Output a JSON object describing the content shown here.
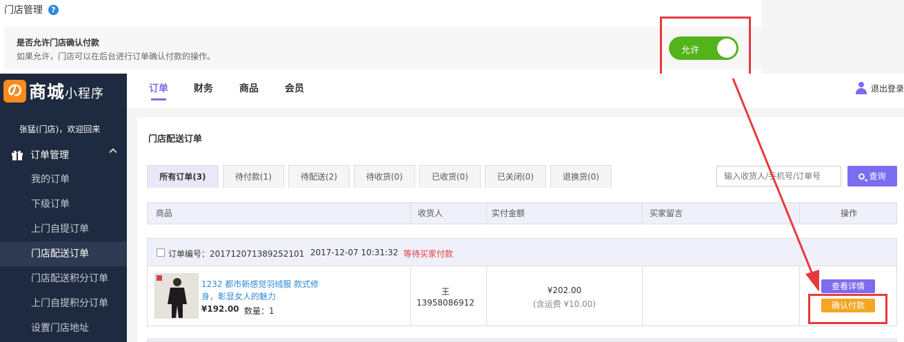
{
  "page": {
    "title": "门店管理",
    "help_icon": "help-icon"
  },
  "setting": {
    "title": "是否允许门店确认付款",
    "description": "如果允许，门店可以在后台进行订单确认付款的操作。",
    "toggle_label": "允许",
    "toggle_on": true,
    "toggle_color": "#52b31a"
  },
  "sidebar": {
    "logo_mark": "の",
    "logo_text": "商城",
    "logo_small": "小程序",
    "welcome": "张猛(门店)，欢迎回来",
    "group_label": "订单管理",
    "items": [
      {
        "label": "我的订单",
        "active": false
      },
      {
        "label": "下级订单",
        "active": false
      },
      {
        "label": "上门自提订单",
        "active": false
      },
      {
        "label": "门店配送订单",
        "active": true
      },
      {
        "label": "门店配送积分订单",
        "active": false
      },
      {
        "label": "上门自提积分订单",
        "active": false
      },
      {
        "label": "设置门店地址",
        "active": false
      }
    ]
  },
  "header": {
    "nav": [
      "订单",
      "财务",
      "商品",
      "会员"
    ],
    "active_nav": "订单",
    "logout": "退出登录"
  },
  "main": {
    "section_title": "门店配送订单",
    "tabs": [
      "所有订单(3)",
      "待付款(1)",
      "待配送(2)",
      "待收货(0)",
      "已收货(0)",
      "已关闭(0)",
      "退换货(0)"
    ],
    "search_placeholder": "输入收货人/手机号/订单号",
    "search_button": "查询",
    "columns": [
      "商品",
      "收货人",
      "实付金额",
      "买家留言",
      "操作"
    ]
  },
  "order": {
    "number_label": "订单编号：201712071389252101",
    "time": "2017-12-07 10:31:32",
    "status": "等待买家付款",
    "product_name": "1232 都市新感觉羽绒服 款式修身，彰显女人的魅力",
    "price": "¥192.00",
    "quantity": "数量：1",
    "receiver": "王",
    "phone": "13958086912",
    "amount": "¥202.00",
    "freight": "(含运费 ¥10.00)",
    "buyer_note": "",
    "detail_button": "查看详情",
    "pay_button": "确认付款"
  },
  "colors": {
    "accent": "#7b6cf0",
    "sidebar": "#1e2a3f",
    "annotation": "#e8383d",
    "pay": "#f5a623"
  }
}
